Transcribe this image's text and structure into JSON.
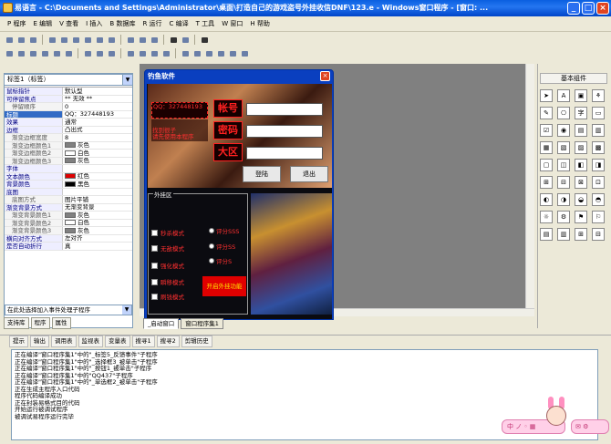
{
  "title": "易语言 - C:\\Documents and Settings\\Administrator\\桌面\\打造自己的游戏盗号外挂收信DNF\\123.e - Windows窗口程序 - [窗口: ...",
  "menu": [
    "P 程序",
    "E 编辑",
    "V 查看",
    "I 插入",
    "B 数据库",
    "R 运行",
    "C 编译",
    "T 工具",
    "W 窗口",
    "H 帮助"
  ],
  "left_panel": {
    "combo": "标签1（标签）",
    "properties": [
      {
        "k": "鼠标指针",
        "v": "默认型",
        "sub": false
      },
      {
        "k": "可停留焦点",
        "v": "** 无效 **",
        "sub": false
      },
      {
        "k": "停留顺序",
        "v": "0",
        "sub": true
      },
      {
        "k": "标题",
        "v": "QQ：327448193",
        "sub": false,
        "sel": true
      },
      {
        "k": "效果",
        "v": "通常",
        "sub": false
      },
      {
        "k": "边框",
        "v": "凸出式",
        "sub": false
      },
      {
        "k": "渐变边框宽度",
        "v": "8",
        "sub": true
      },
      {
        "k": "渐变边框颜色1",
        "v": "灰色",
        "sub": true,
        "sw": "#808080"
      },
      {
        "k": "渐变边框颜色2",
        "v": "白色",
        "sub": true,
        "sw": "#ffffff"
      },
      {
        "k": "渐变边框颜色3",
        "v": "灰色",
        "sub": true,
        "sw": "#808080"
      },
      {
        "k": "字体",
        "v": "",
        "sub": false
      },
      {
        "k": "文本颜色",
        "v": "红色",
        "sub": false,
        "sw": "#e00000"
      },
      {
        "k": "背景颜色",
        "v": "黑色",
        "sub": false,
        "sw": "#000000"
      },
      {
        "k": "底图",
        "v": "",
        "sub": false
      },
      {
        "k": "底图方式",
        "v": "图片平铺",
        "sub": true
      },
      {
        "k": "渐变背景方式",
        "v": "无渐变背景",
        "sub": false
      },
      {
        "k": "渐变背景颜色1",
        "v": "灰色",
        "sub": true,
        "sw": "#808080"
      },
      {
        "k": "渐变背景颜色2",
        "v": "白色",
        "sub": true,
        "sw": "#ffffff"
      },
      {
        "k": "渐变背景颜色3",
        "v": "灰色",
        "sub": true,
        "sw": "#808080"
      },
      {
        "k": "横向对齐方式",
        "v": "左对齐",
        "sub": false
      },
      {
        "k": "是否自动折行",
        "v": "真",
        "sub": false
      }
    ],
    "event_combo": "在此处选择加入事件处理子程序",
    "tabs": [
      "支持库",
      "程序",
      "属性"
    ]
  },
  "form": {
    "title": "钓鱼软件",
    "close": "×",
    "qq_text": "QQ：327448193",
    "desc_text": "找到很子\n请先使用本程序",
    "labels": [
      "帐号",
      "密码",
      "大区"
    ],
    "login_btn": "登陆",
    "exit_btn": "退出",
    "group": "外挂区",
    "checks": [
      "秒杀模式",
      "无敌模式",
      "强化模式",
      "瞬移模式",
      "刷钱模式"
    ],
    "radios": [
      "评分SSS",
      "评分SS",
      "评分S"
    ],
    "start_btn": "开启外挂功能"
  },
  "design_tabs": [
    "_启动窗口",
    "窗口程序集1"
  ],
  "right_panel": {
    "title": "基本组件"
  },
  "bottom_tabs": [
    "提示",
    "输出",
    "调用表",
    "监视表",
    "变量表",
    "搜寻1",
    "搜寻2",
    "剪辑历史"
  ],
  "output_lines": [
    "正在编译\"窗口程序集1\"中的\"_标签5_反馈事件\"子程序",
    "正在编译\"窗口程序集1\"中的\"_选择框3_被单击\"子程序",
    "正在编译\"窗口程序集1\"中的\"_按钮1_被单击\"子程序",
    "正在编译\"窗口程序集1\"中的\"QQ437\"子程序",
    "正在编译\"窗口程序集1\"中的\"_单选框2_被单击\"子程序",
    "正在生成主程序入口代码",
    "程序代码编译成功",
    "正在封装易格式目的代码",
    "开始运行被调试程序",
    "被调试易程序运行完毕"
  ],
  "ime_text": "中 ノ ◦ ▦",
  "ime_text2": "✉ ⚙"
}
